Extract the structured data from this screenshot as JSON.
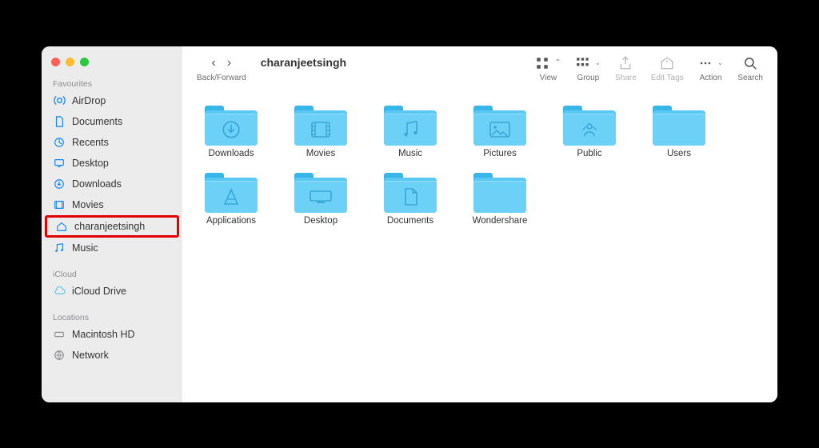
{
  "window": {
    "title": "charanjeetsingh"
  },
  "toolbar": {
    "back_forward": "Back/Forward",
    "view": "View",
    "group": "Group",
    "share": "Share",
    "edit_tags": "Edit Tags",
    "action": "Action",
    "search": "Search"
  },
  "sidebar": {
    "sections": {
      "favourites": {
        "label": "Favourites",
        "items": [
          {
            "label": "AirDrop",
            "icon": "airdrop"
          },
          {
            "label": "Documents",
            "icon": "doc"
          },
          {
            "label": "Recents",
            "icon": "clock"
          },
          {
            "label": "Desktop",
            "icon": "desktop"
          },
          {
            "label": "Downloads",
            "icon": "download"
          },
          {
            "label": "Movies",
            "icon": "movies"
          },
          {
            "label": "charanjeetsingh",
            "icon": "home",
            "circled": true
          },
          {
            "label": "Music",
            "icon": "music"
          }
        ]
      },
      "icloud": {
        "label": "iCloud",
        "items": [
          {
            "label": "iCloud Drive",
            "icon": "cloud"
          }
        ]
      },
      "locations": {
        "label": "Locations",
        "items": [
          {
            "label": "Macintosh HD",
            "icon": "disk"
          },
          {
            "label": "Network",
            "icon": "network"
          }
        ]
      }
    }
  },
  "folders": [
    {
      "label": "Downloads",
      "glyph": "↓"
    },
    {
      "label": "Movies",
      "glyph": "film"
    },
    {
      "label": "Music",
      "glyph": "♪"
    },
    {
      "label": "Pictures",
      "glyph": "img"
    },
    {
      "label": "Public",
      "glyph": "share"
    },
    {
      "label": "Users",
      "glyph": ""
    },
    {
      "label": "Applications",
      "glyph": "A"
    },
    {
      "label": "Desktop",
      "glyph": "desk"
    },
    {
      "label": "Documents",
      "glyph": "doc"
    },
    {
      "label": "Wondershare",
      "glyph": ""
    }
  ]
}
